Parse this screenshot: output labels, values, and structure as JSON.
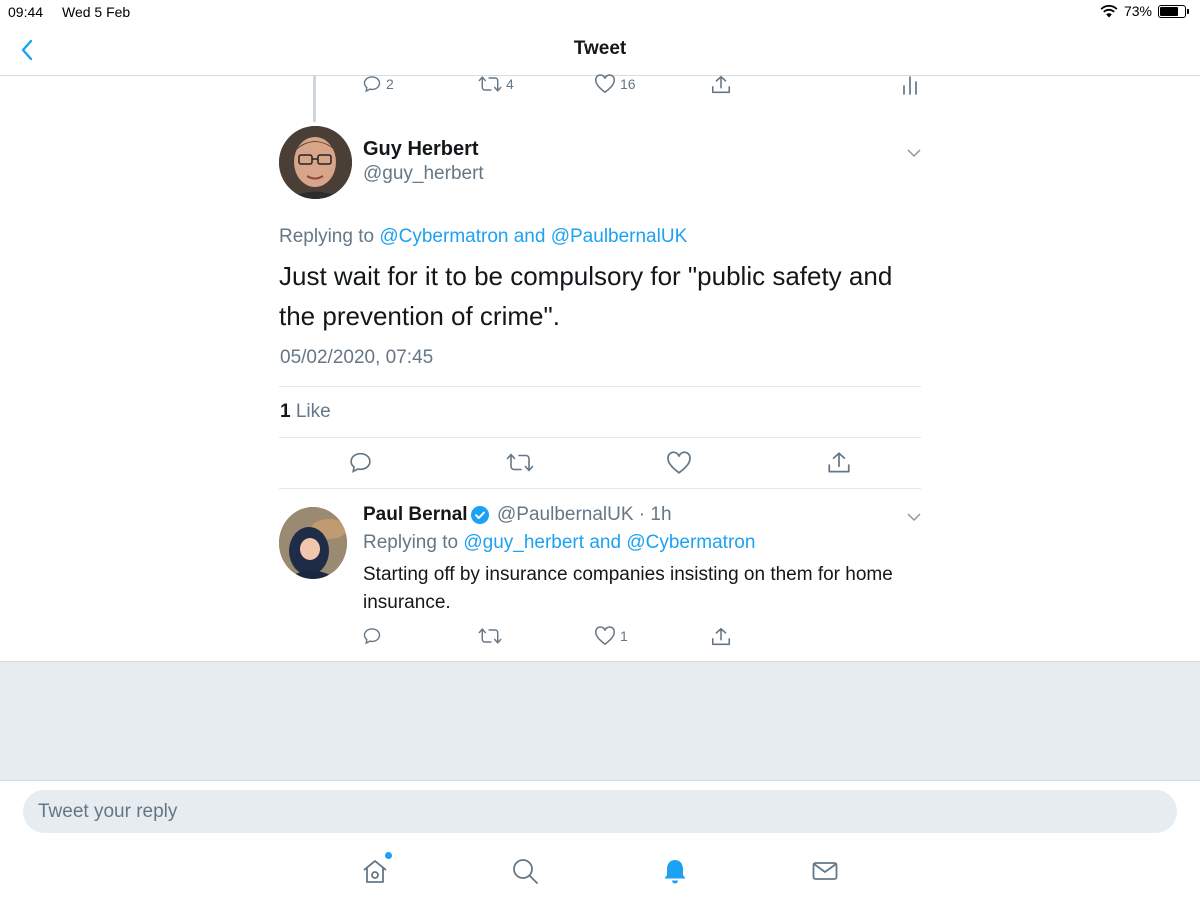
{
  "status_bar": {
    "time": "09:44",
    "date": "Wed 5 Feb",
    "battery": "73%",
    "battery_level": 0.73
  },
  "nav": {
    "title": "Tweet",
    "back_icon": "chevron-left-icon"
  },
  "parent_actions": {
    "replies": "2",
    "retweets": "4",
    "likes": "16"
  },
  "main_tweet": {
    "name": "Guy Herbert",
    "handle": "@guy_herbert",
    "replying_prefix": "Replying to ",
    "replying_to_1": "@Cybermatron",
    "replying_and": " and ",
    "replying_to_2": "@PaulbernalUK",
    "text": "Just wait for it to be compulsory for \"public safety and the prevention of crime\".",
    "timestamp": "05/02/2020, 07:45",
    "likes_count": "1",
    "likes_label": "Like"
  },
  "reply_tweet": {
    "name": "Paul Bernal",
    "handle_time": "@PaulbernalUK · 1h",
    "replying_prefix": "Replying to ",
    "replying_to_1": "@guy_herbert",
    "replying_and": " and ",
    "replying_to_2": "@Cybermatron",
    "text": "Starting off by insurance companies insisting on them for home insurance.",
    "likes": "1"
  },
  "composer": {
    "placeholder": "Tweet your reply"
  },
  "tabs": [
    "home-icon",
    "search-icon",
    "notifications-icon",
    "messages-icon"
  ],
  "colors": {
    "accent": "#1da1f2",
    "secondary_text": "#657786",
    "background_gray": "#e6ecf0"
  }
}
